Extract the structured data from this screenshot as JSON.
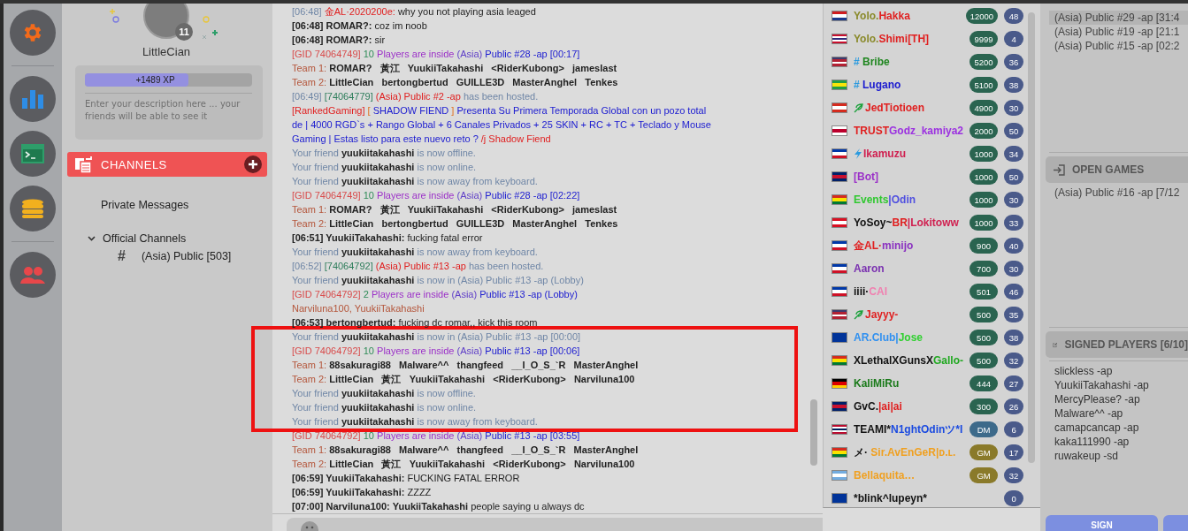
{
  "profile": {
    "name": "LittleCian",
    "level_badge": "11",
    "xp": {
      "text": "+1489 XP",
      "level": 0.62
    },
    "description": {
      "placeholder": "Enter your description here ... your friends will be able to see it"
    }
  },
  "channels": {
    "title": "CHANNELS",
    "private": "Private Messages",
    "group": {
      "label": "Official Channels",
      "expanded": true,
      "children": [
        {
          "icon": "#",
          "label": "(Asia) Public [503]"
        }
      ]
    }
  },
  "chat": {
    "lines": [
      {
        "highlighted": false,
        "segments": [
          {
            "kind": "muted",
            "text": "[06:48]"
          },
          {
            "kind": "hostroom",
            "text": "金AL·2020200e:"
          },
          {
            "kind": "plain",
            "text": "why you not playing asia leaged"
          }
        ]
      },
      {
        "highlighted": false,
        "segments": [
          {
            "kind": "nick",
            "text": "[06:48] ROMAR?:"
          },
          {
            "kind": "plain",
            "text": "coz im noob"
          }
        ]
      },
      {
        "highlighted": false,
        "segments": [
          {
            "kind": "nick",
            "text": "[06:48] ROMAR?:"
          },
          {
            "kind": "plain",
            "text": "sir"
          }
        ]
      },
      {
        "highlighted": false,
        "segments": [
          {
            "kind": "gid",
            "text": "[GID 74064749]"
          },
          {
            "kind": "count",
            "text": "10"
          },
          {
            "kind": "inside",
            "text": "Players are inside"
          },
          {
            "kind": "region",
            "text": "(Asia)"
          },
          {
            "kind": "room",
            "text": "Public #28 -ap [00:17]"
          }
        ]
      },
      {
        "highlighted": false,
        "segments": [
          {
            "kind": "team",
            "text": "Team 1:"
          },
          {
            "kind": "nick",
            "text": "ROMAR?   黃江   YuukiiTakahashi   <RiderKubong>   jameslast"
          }
        ]
      },
      {
        "highlighted": false,
        "segments": [
          {
            "kind": "team",
            "text": "Team 2:"
          },
          {
            "kind": "nick",
            "text": "LittleCian   bertongbertud   GUILLE3D   MasterAnghel   Tenkes"
          }
        ]
      },
      {
        "highlighted": false,
        "segments": [
          {
            "kind": "muted",
            "text": "[06:49]"
          },
          {
            "kind": "hostid",
            "text": "[74064779]"
          },
          {
            "kind": "hostroom",
            "text": "(Asia) Public #2 -ap"
          },
          {
            "kind": "muted",
            "text": "has been hosted."
          }
        ]
      },
      {
        "highlighted": false,
        "segments": [
          {
            "kind": "hostroom",
            "text": "[RankedGaming]"
          },
          {
            "kind": "orange",
            "text": "["
          },
          {
            "kind": "room",
            "text": "SHADOW FIEND"
          },
          {
            "kind": "orange",
            "text": "]"
          },
          {
            "kind": "room",
            "text": "Presenta Su Primera Temporada Global con un pozo total de | 4000 RGD`s + Rango Global + 6 Canales Privados + 25 SKIN + RC + TC + Teclado y Mouse Gaming | Estas listo para este nuevo reto ?"
          },
          {
            "kind": "hostroom",
            "text": "/j Shadow Fiend"
          }
        ]
      },
      {
        "highlighted": false,
        "segments": [
          {
            "kind": "muted",
            "text": "Your friend"
          },
          {
            "kind": "nick",
            "text": "yuukiitakahashi"
          },
          {
            "kind": "muted",
            "text": "is now offline."
          }
        ]
      },
      {
        "highlighted": false,
        "segments": [
          {
            "kind": "muted",
            "text": "Your friend"
          },
          {
            "kind": "nick",
            "text": "yuukiitakahashi"
          },
          {
            "kind": "muted",
            "text": "is now online."
          }
        ]
      },
      {
        "highlighted": false,
        "segments": [
          {
            "kind": "muted",
            "text": "Your friend"
          },
          {
            "kind": "nick",
            "text": "yuukiitakahashi"
          },
          {
            "kind": "muted",
            "text": "is now away from keyboard."
          }
        ]
      },
      {
        "highlighted": false,
        "segments": [
          {
            "kind": "gid",
            "text": "[GID 74064749]"
          },
          {
            "kind": "count",
            "text": "10"
          },
          {
            "kind": "inside",
            "text": "Players are inside"
          },
          {
            "kind": "region",
            "text": "(Asia)"
          },
          {
            "kind": "room",
            "text": "Public #28 -ap [02:22]"
          }
        ]
      },
      {
        "highlighted": false,
        "segments": [
          {
            "kind": "team",
            "text": "Team 1:"
          },
          {
            "kind": "nick",
            "text": "ROMAR?   黃江   YuukiiTakahashi   <RiderKubong>   jameslast"
          }
        ]
      },
      {
        "highlighted": false,
        "segments": [
          {
            "kind": "team",
            "text": "Team 2:"
          },
          {
            "kind": "nick",
            "text": "LittleCian   bertongbertud   GUILLE3D   MasterAnghel   Tenkes"
          }
        ]
      },
      {
        "highlighted": false,
        "segments": [
          {
            "kind": "nick",
            "text": "[06:51] YuukiiTakahashi:"
          },
          {
            "kind": "plain",
            "text": "fucking fatal error"
          }
        ]
      },
      {
        "highlighted": false,
        "segments": [
          {
            "kind": "muted",
            "text": "Your friend"
          },
          {
            "kind": "nick",
            "text": "yuukiitakahashi"
          },
          {
            "kind": "muted",
            "text": "is now away from keyboard."
          }
        ]
      },
      {
        "highlighted": false,
        "segments": [
          {
            "kind": "muted",
            "text": "[06:52]"
          },
          {
            "kind": "hostid",
            "text": "[74064792]"
          },
          {
            "kind": "hostroom",
            "text": "(Asia) Public #13 -ap"
          },
          {
            "kind": "muted",
            "text": "has been hosted."
          }
        ]
      },
      {
        "highlighted": false,
        "segments": [
          {
            "kind": "muted",
            "text": "Your friend"
          },
          {
            "kind": "nick",
            "text": "yuukiitakahashi"
          },
          {
            "kind": "muted",
            "text": "is now in (Asia) Public #13 -ap (Lobby)"
          }
        ]
      },
      {
        "highlighted": false,
        "segments": [
          {
            "kind": "gid",
            "text": "[GID 74064792]"
          },
          {
            "kind": "count",
            "text": "2"
          },
          {
            "kind": "inside",
            "text": "Players are inside"
          },
          {
            "kind": "region",
            "text": "(Asia)"
          },
          {
            "kind": "room",
            "text": "Public #13 -ap (Lobby)"
          }
        ]
      },
      {
        "highlighted": false,
        "segments": [
          {
            "kind": "team",
            "text": "Narviluna100, YuukiiTakahashi"
          }
        ]
      },
      {
        "highlighted": false,
        "segments": [
          {
            "kind": "nick",
            "text": "[06:53] bertongbertud:"
          },
          {
            "kind": "plain",
            "text": "fucking dc romar,, kick this room"
          }
        ]
      },
      {
        "highlighted": true,
        "segments": [
          {
            "kind": "muted",
            "text": "Your friend"
          },
          {
            "kind": "nick",
            "text": "yuukiitakahashi"
          },
          {
            "kind": "muted",
            "text": "is now in (Asia) Public #13 -ap [00:00]"
          }
        ]
      },
      {
        "highlighted": true,
        "segments": [
          {
            "kind": "gid",
            "text": "[GID 74064792]"
          },
          {
            "kind": "count",
            "text": "10"
          },
          {
            "kind": "inside",
            "text": "Players are inside"
          },
          {
            "kind": "region",
            "text": "(Asia)"
          },
          {
            "kind": "room",
            "text": "Public #13 -ap [00:06]"
          }
        ]
      },
      {
        "highlighted": true,
        "segments": [
          {
            "kind": "team",
            "text": "Team 1:"
          },
          {
            "kind": "nick",
            "text": "88sakuragi88   Malware^^   thangfeed   __I_O_S_`R   MasterAnghel"
          }
        ]
      },
      {
        "highlighted": true,
        "segments": [
          {
            "kind": "team",
            "text": "Team 2:"
          },
          {
            "kind": "nick",
            "text": "LittleCian   黃江   YuukiiTakahashi   <RiderKubong>   Narviluna100"
          }
        ]
      },
      {
        "highlighted": true,
        "segments": [
          {
            "kind": "muted",
            "text": "Your friend"
          },
          {
            "kind": "nick",
            "text": "yuukiitakahashi"
          },
          {
            "kind": "muted",
            "text": "is now offline."
          }
        ]
      },
      {
        "highlighted": true,
        "segments": [
          {
            "kind": "muted",
            "text": "Your friend"
          },
          {
            "kind": "nick",
            "text": "yuukiitakahashi"
          },
          {
            "kind": "muted",
            "text": "is now online."
          }
        ]
      },
      {
        "highlighted": true,
        "segments": [
          {
            "kind": "muted",
            "text": "Your friend"
          },
          {
            "kind": "nick",
            "text": "yuukiitakahashi"
          },
          {
            "kind": "muted",
            "text": "is now away from keyboard."
          }
        ]
      },
      {
        "highlighted": false,
        "segments": [
          {
            "kind": "gid",
            "text": "[GID 74064792]"
          },
          {
            "kind": "count",
            "text": "10"
          },
          {
            "kind": "inside",
            "text": "Players are inside"
          },
          {
            "kind": "region",
            "text": "(Asia)"
          },
          {
            "kind": "room",
            "text": "Public #13 -ap [03:55]"
          }
        ]
      },
      {
        "highlighted": false,
        "segments": [
          {
            "kind": "team",
            "text": "Team 1:"
          },
          {
            "kind": "nick",
            "text": "88sakuragi88   Malware^^   thangfeed   __I_O_S_`R   MasterAnghel"
          }
        ]
      },
      {
        "highlighted": false,
        "segments": [
          {
            "kind": "team",
            "text": "Team 2:"
          },
          {
            "kind": "nick",
            "text": "LittleCian   黃江   YuukiiTakahashi   <RiderKubong>   Narviluna100"
          }
        ]
      },
      {
        "highlighted": false,
        "segments": [
          {
            "kind": "nick",
            "text": "[06:59] YuukiiTakahashi:"
          },
          {
            "kind": "plain",
            "text": "FUCKING FATAL ERROR"
          }
        ]
      },
      {
        "highlighted": false,
        "segments": [
          {
            "kind": "nick",
            "text": "[06:59] YuukiiTakahashi:"
          },
          {
            "kind": "plain",
            "text": "ZZZZ"
          }
        ]
      },
      {
        "highlighted": false,
        "segments": [
          {
            "kind": "nick",
            "text": "[07:00] Narviluna100:"
          },
          {
            "kind": "nick",
            "text": "YuukiiTakahashi"
          },
          {
            "kind": "plain",
            "text": "people saying u always dc"
          }
        ]
      }
    ]
  },
  "players": [
    {
      "name": [
        {
          "text": "Yolo.",
          "color": "#8a8a2a"
        },
        {
          "text": "Hakka",
          "color": "#e02020"
        }
      ],
      "badge": {
        "kind": "xp",
        "text": "12000"
      },
      "level": "48"
    },
    {
      "name": [
        {
          "text": "Yolo.",
          "color": "#8a8a2a"
        },
        {
          "text": "Shimi[TH]",
          "color": "#e02020"
        }
      ],
      "badge": {
        "kind": "xp",
        "text": "9999"
      },
      "level": "4"
    },
    {
      "name": [
        {
          "text": "# ",
          "color": "#2a9adf"
        },
        {
          "text": "Bribe",
          "color": "#1f861f"
        }
      ],
      "badge": {
        "kind": "xp",
        "text": "5200"
      },
      "level": "36"
    },
    {
      "name": [
        {
          "text": "# ",
          "color": "#2a9adf"
        },
        {
          "text": "Lugano",
          "color": "#1a1ad0"
        }
      ],
      "badge": {
        "kind": "xp",
        "text": "5100"
      },
      "level": "38"
    },
    {
      "name": [
        {
          "text": "JedTiotioen",
          "color": "#e02020"
        }
      ],
      "badge": {
        "kind": "xp",
        "text": "4900"
      },
      "level": "30"
    },
    {
      "name": [
        {
          "text": "TRUST",
          "color": "#e02020"
        },
        {
          "text": "Godz_kamiya2",
          "color": "#9b30e0"
        }
      ],
      "badge": {
        "kind": "xp",
        "text": "2000"
      },
      "level": "50"
    },
    {
      "name": [
        {
          "text": "Ikamuzu",
          "color": "#d02050"
        }
      ],
      "badge": {
        "kind": "xp",
        "text": "1000"
      },
      "level": "34"
    },
    {
      "name": [
        {
          "text": "[Bot]",
          "color": "#9b30c8"
        }
      ],
      "badge": {
        "kind": "xp",
        "text": "1000"
      },
      "level": "50"
    },
    {
      "name": [
        {
          "text": "Events",
          "color": "#30c830"
        },
        {
          "text": "|Odin",
          "color": "#5050e0"
        }
      ],
      "badge": {
        "kind": "xp",
        "text": "1000"
      },
      "level": "30"
    },
    {
      "name": [
        {
          "text": "YoSoy~",
          "color": "#111111"
        },
        {
          "text": "BR",
          "color": "#e02020"
        },
        {
          "text": "|Lokitoww",
          "color": "#d02050"
        }
      ],
      "badge": {
        "kind": "xp",
        "text": "1000"
      },
      "level": "33"
    },
    {
      "name": [
        {
          "text": "金AL·",
          "color": "#e02020"
        },
        {
          "text": "minijo",
          "color": "#8a30c0"
        }
      ],
      "badge": {
        "kind": "xp",
        "text": "900"
      },
      "level": "40"
    },
    {
      "name": [
        {
          "text": "Aaron",
          "color": "#7a30b0"
        }
      ],
      "badge": {
        "kind": "xp",
        "text": "700"
      },
      "level": "30"
    },
    {
      "name": [
        {
          "text": "iiii·",
          "color": "#111111"
        },
        {
          "text": "CAI",
          "color": "#f080b0"
        }
      ],
      "badge": {
        "kind": "xp",
        "text": "501"
      },
      "level": "46"
    },
    {
      "name": [
        {
          "text": "Jayyy-",
          "color": "#e02020"
        }
      ],
      "badge": {
        "kind": "xp",
        "text": "500"
      },
      "level": "35"
    },
    {
      "name": [
        {
          "text": "AR.Club|",
          "color": "#3090f0"
        },
        {
          "text": "Jose",
          "color": "#30d030"
        }
      ],
      "badge": {
        "kind": "xp",
        "text": "500"
      },
      "level": "38"
    },
    {
      "name": [
        {
          "text": "XLethalXGunsX",
          "color": "#111111"
        },
        {
          "text": "Gallo-",
          "color": "#1fa81f"
        }
      ],
      "badge": {
        "kind": "xp",
        "text": "500"
      },
      "level": "32"
    },
    {
      "name": [
        {
          "text": "KaliMiRu",
          "color": "#1a7a1a"
        }
      ],
      "badge": {
        "kind": "xp",
        "text": "444"
      },
      "level": "27"
    },
    {
      "name": [
        {
          "text": "GvC.",
          "color": "#111111"
        },
        {
          "text": "|ai|ai",
          "color": "#e02020"
        }
      ],
      "badge": {
        "kind": "xp",
        "text": "300"
      },
      "level": "26"
    },
    {
      "name": [
        {
          "text": "TEAMI*",
          "color": "#111111"
        },
        {
          "text": "N1ghtOdinツ*I",
          "color": "#1a4ae0"
        }
      ],
      "badge": {
        "kind": "dm",
        "text": "DM"
      },
      "level": "6"
    },
    {
      "name": [
        {
          "text": "メ· ",
          "color": "#111111"
        },
        {
          "text": "Sir.AvEnGeR|ᴅ.ʟ.",
          "color": "#f0a020"
        }
      ],
      "badge": {
        "kind": "gm",
        "text": "GM"
      },
      "level": "17"
    },
    {
      "name": [
        {
          "text": "Bellaquita…",
          "color": "#f0a020"
        }
      ],
      "badge": {
        "kind": "gm",
        "text": "GM"
      },
      "level": "32"
    },
    {
      "name": [
        {
          "text": "*blink^lupeyn*",
          "color": "#111111"
        }
      ],
      "level": "0"
    }
  ],
  "games": {
    "running": [
      {
        "label": "(Asia) Public #29 -ap [31:4",
        "selected": true
      },
      {
        "label": "(Asia) Public #19 -ap [21:1",
        "selected": false
      },
      {
        "label": "(Asia) Public #15 -ap [02:2",
        "selected": false
      }
    ],
    "open_title": "OPEN GAMES",
    "open": [
      {
        "label": "(Asia) Public #16 -ap [7/12",
        "selected": false
      }
    ],
    "signed_title": "SIGNED PLAYERS [6/10]",
    "signed": [
      "slickless -ap",
      "YuukiiTakahashi -ap",
      "MercyPlease? -ap",
      "Malware^^ -ap",
      "camapcancap -ap",
      "kaka111990 -ap",
      "ruwakeup -sd"
    ],
    "sign_button": "SIGN"
  }
}
